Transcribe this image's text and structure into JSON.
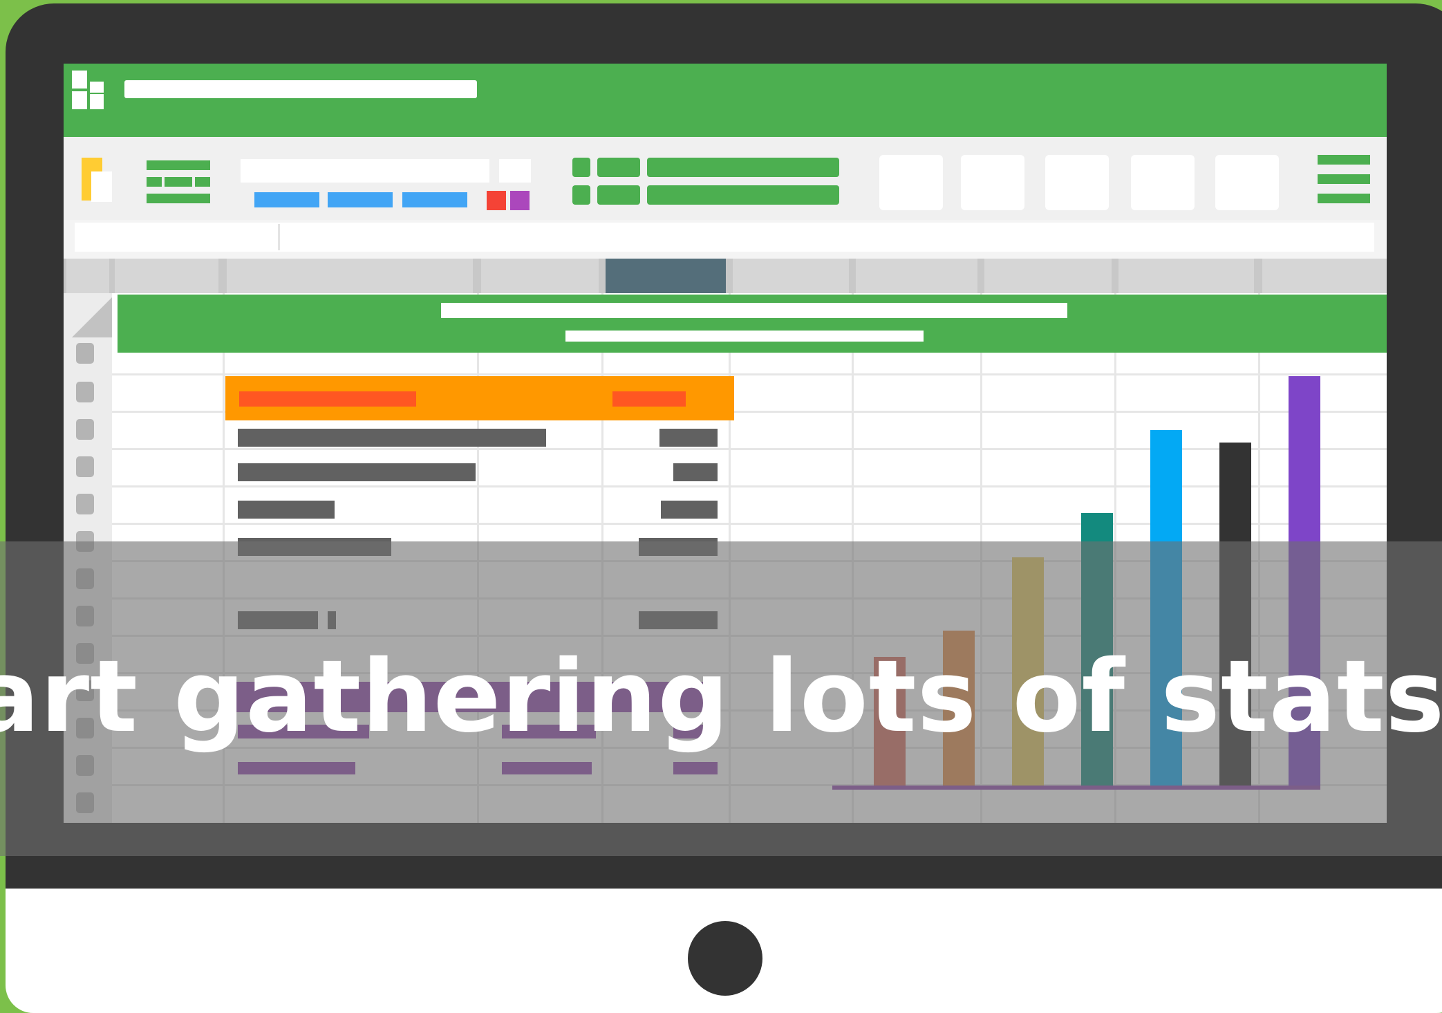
{
  "caption": {
    "text": "art gathering lots of stats."
  },
  "colors": {
    "background": "#7cc04a",
    "bezel": "#333333",
    "accent_green": "#4caf50",
    "header_orange": "#ff9800",
    "highlight_purple": "#8e44ad",
    "selected_column": "#546e7a"
  },
  "icons": [
    "spreadsheet-logo-icon",
    "menu-icon"
  ],
  "chart_colors": [
    "#d46a5a",
    "#e08a45",
    "#e3c85a",
    "#138a7e",
    "#03a9f4",
    "#333333",
    "#7e45c8"
  ]
}
